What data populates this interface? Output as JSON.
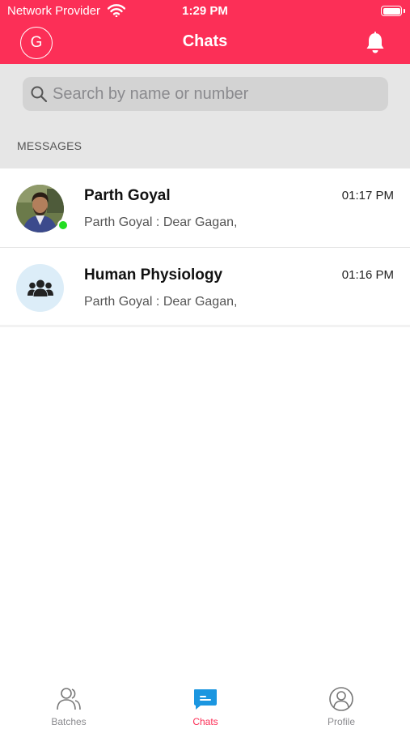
{
  "status_bar": {
    "carrier": "Network Provider",
    "time": "1:29 PM"
  },
  "header": {
    "avatar_initial": "G",
    "title": "Chats"
  },
  "search": {
    "placeholder": "Search by name or number"
  },
  "section": {
    "label": "MESSAGES"
  },
  "chats": [
    {
      "name": "Parth Goyal",
      "time": "01:17 PM",
      "preview": "Parth Goyal : Dear Gagan,",
      "online": true,
      "icon": "user-photo"
    },
    {
      "name": "Human Physiology",
      "time": "01:16 PM",
      "preview": "Parth Goyal : Dear Gagan,",
      "online": false,
      "icon": "group-icon"
    }
  ],
  "tabs": [
    {
      "label": "Batches",
      "icon": "batches-icon",
      "active": false
    },
    {
      "label": "Chats",
      "icon": "chat-bubble-icon",
      "active": true
    },
    {
      "label": "Profile",
      "icon": "profile-icon",
      "active": false
    }
  ],
  "colors": {
    "brand": "#fc2f57",
    "chat_active": "#1b96e0",
    "online": "#22dd22"
  }
}
